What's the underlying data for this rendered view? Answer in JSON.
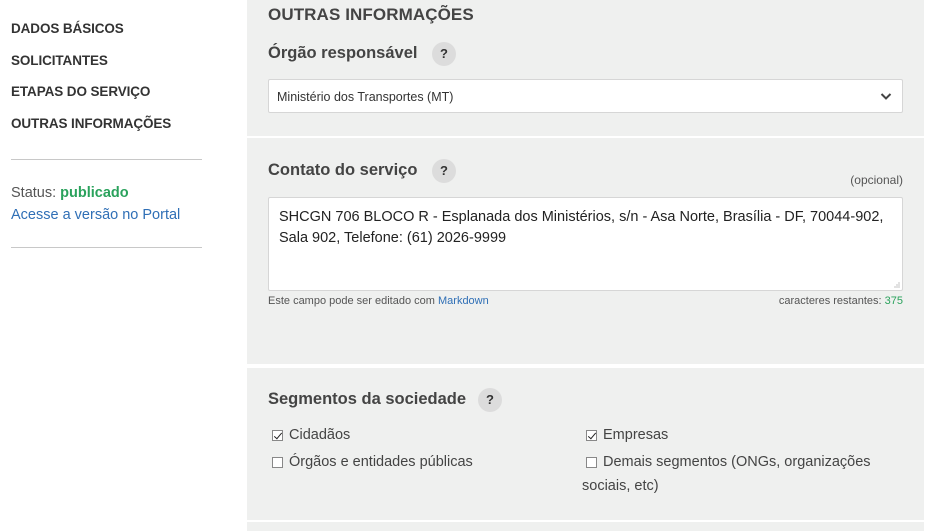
{
  "sidebar": {
    "items": [
      {
        "label": "DADOS BÁSICOS"
      },
      {
        "label": "SOLICITANTES"
      },
      {
        "label": "ETAPAS DO SERVIÇO"
      },
      {
        "label": "OUTRAS INFORMAÇÕES"
      }
    ],
    "status_label": "Status:",
    "status_value": "publicado",
    "portal_link": "Acesse a versão no Portal"
  },
  "main": {
    "section_title": "OUTRAS INFORMAÇÕES",
    "orgao": {
      "label": "Órgão responsável",
      "help": "?",
      "selected": "Ministério dos Transportes (MT)"
    },
    "contato": {
      "label": "Contato do serviço",
      "help": "?",
      "optional": "(opcional)",
      "value": "SHCGN 706 BLOCO R - Esplanada dos Ministérios, s/n - Asa Norte, Brasília - DF, 70044-902, Sala 902, Telefone: (61) 2026-9999",
      "hint_prefix": "Este campo pode ser editado com",
      "hint_link": "Markdown",
      "remaining_label": "caracteres restantes:",
      "remaining_count": "375"
    },
    "segmentos": {
      "label": "Segmentos da sociedade",
      "help": "?",
      "options": [
        {
          "label": "Cidadãos",
          "checked": true
        },
        {
          "label": "Empresas",
          "checked": true
        },
        {
          "label": "Órgãos e entidades públicas",
          "checked": false
        },
        {
          "label": "Demais segmentos (ONGs, organizações sociais, etc)",
          "checked": false
        }
      ]
    }
  },
  "colors": {
    "panel_bg": "#eff0ef",
    "status_green": "#2aa25c",
    "link_blue": "#2f6fb6"
  }
}
